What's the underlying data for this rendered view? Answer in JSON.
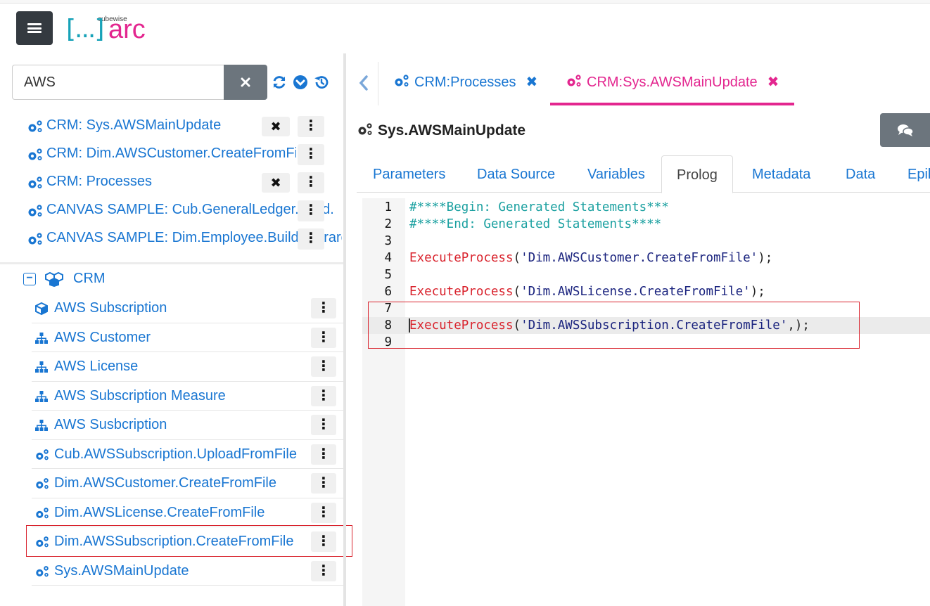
{
  "header": {
    "logo_brackets": "[...]",
    "logo_text": "arc",
    "logo_brand": "cubewise"
  },
  "search": {
    "value": "AWS",
    "placeholder": ""
  },
  "recent": [
    {
      "label": "CRM: Sys.AWSMainUpdate",
      "closable": true
    },
    {
      "label": "CRM: Dim.AWSCustomer.CreateFromFile",
      "closable": false
    },
    {
      "label": "CRM: Processes",
      "closable": true
    },
    {
      "label": "CANVAS SAMPLE: Cub.GeneralLedger.Load.Demo",
      "closable": false
    },
    {
      "label": "CANVAS SAMPLE: Dim.Employee.Build.Hierarchy.arc",
      "closable": false
    }
  ],
  "tree": {
    "root_label": "CRM",
    "items": [
      {
        "label": "AWS Subscription",
        "icon": "cube-icon"
      },
      {
        "label": "AWS Customer",
        "icon": "hierarchy-icon"
      },
      {
        "label": "AWS License",
        "icon": "hierarchy-icon"
      },
      {
        "label": "AWS Subscription Measure",
        "icon": "hierarchy-icon"
      },
      {
        "label": "AWS Susbcription",
        "icon": "hierarchy-icon"
      },
      {
        "label": "Cub.AWSSubscription.UploadFromFile",
        "icon": "gears-icon"
      },
      {
        "label": "Dim.AWSCustomer.CreateFromFile",
        "icon": "gears-icon"
      },
      {
        "label": "Dim.AWSLicense.CreateFromFile",
        "icon": "gears-icon"
      },
      {
        "label": "Dim.AWSSubscription.CreateFromFile",
        "icon": "gears-icon"
      },
      {
        "label": "Sys.AWSMainUpdate",
        "icon": "gears-icon"
      }
    ]
  },
  "tabs": [
    {
      "label": "CRM:Processes",
      "active": false
    },
    {
      "label": "CRM:Sys.AWSMainUpdate",
      "active": true
    }
  ],
  "editor_title": "Sys.AWSMainUpdate",
  "subtabs": [
    "Parameters",
    "Data Source",
    "Variables",
    "Prolog",
    "Metadata",
    "Data",
    "Epilog"
  ],
  "active_subtab": "Prolog",
  "code": {
    "line_numbers": [
      "1",
      "2",
      "3",
      "4",
      "5",
      "6",
      "7",
      "8",
      "9"
    ],
    "comment1": "#****Begin: Generated Statements***",
    "comment2": "#****End: Generated Statements****",
    "func": "ExecuteProcess",
    "call1_arg": "'Dim.AWSCustomer.CreateFromFile'",
    "call2_arg": "'Dim.AWSLicense.CreateFromFile'",
    "call3_arg": "'Dim.AWSSubscription.CreateFromFile'",
    "open_paren": "(",
    "close_end": ");",
    "close_end_3": ",);"
  },
  "colors": {
    "accent": "#1976d2",
    "brand_pink": "#e3268f",
    "brand_teal": "#17a2b8",
    "highlight_box": "#d9232d"
  }
}
